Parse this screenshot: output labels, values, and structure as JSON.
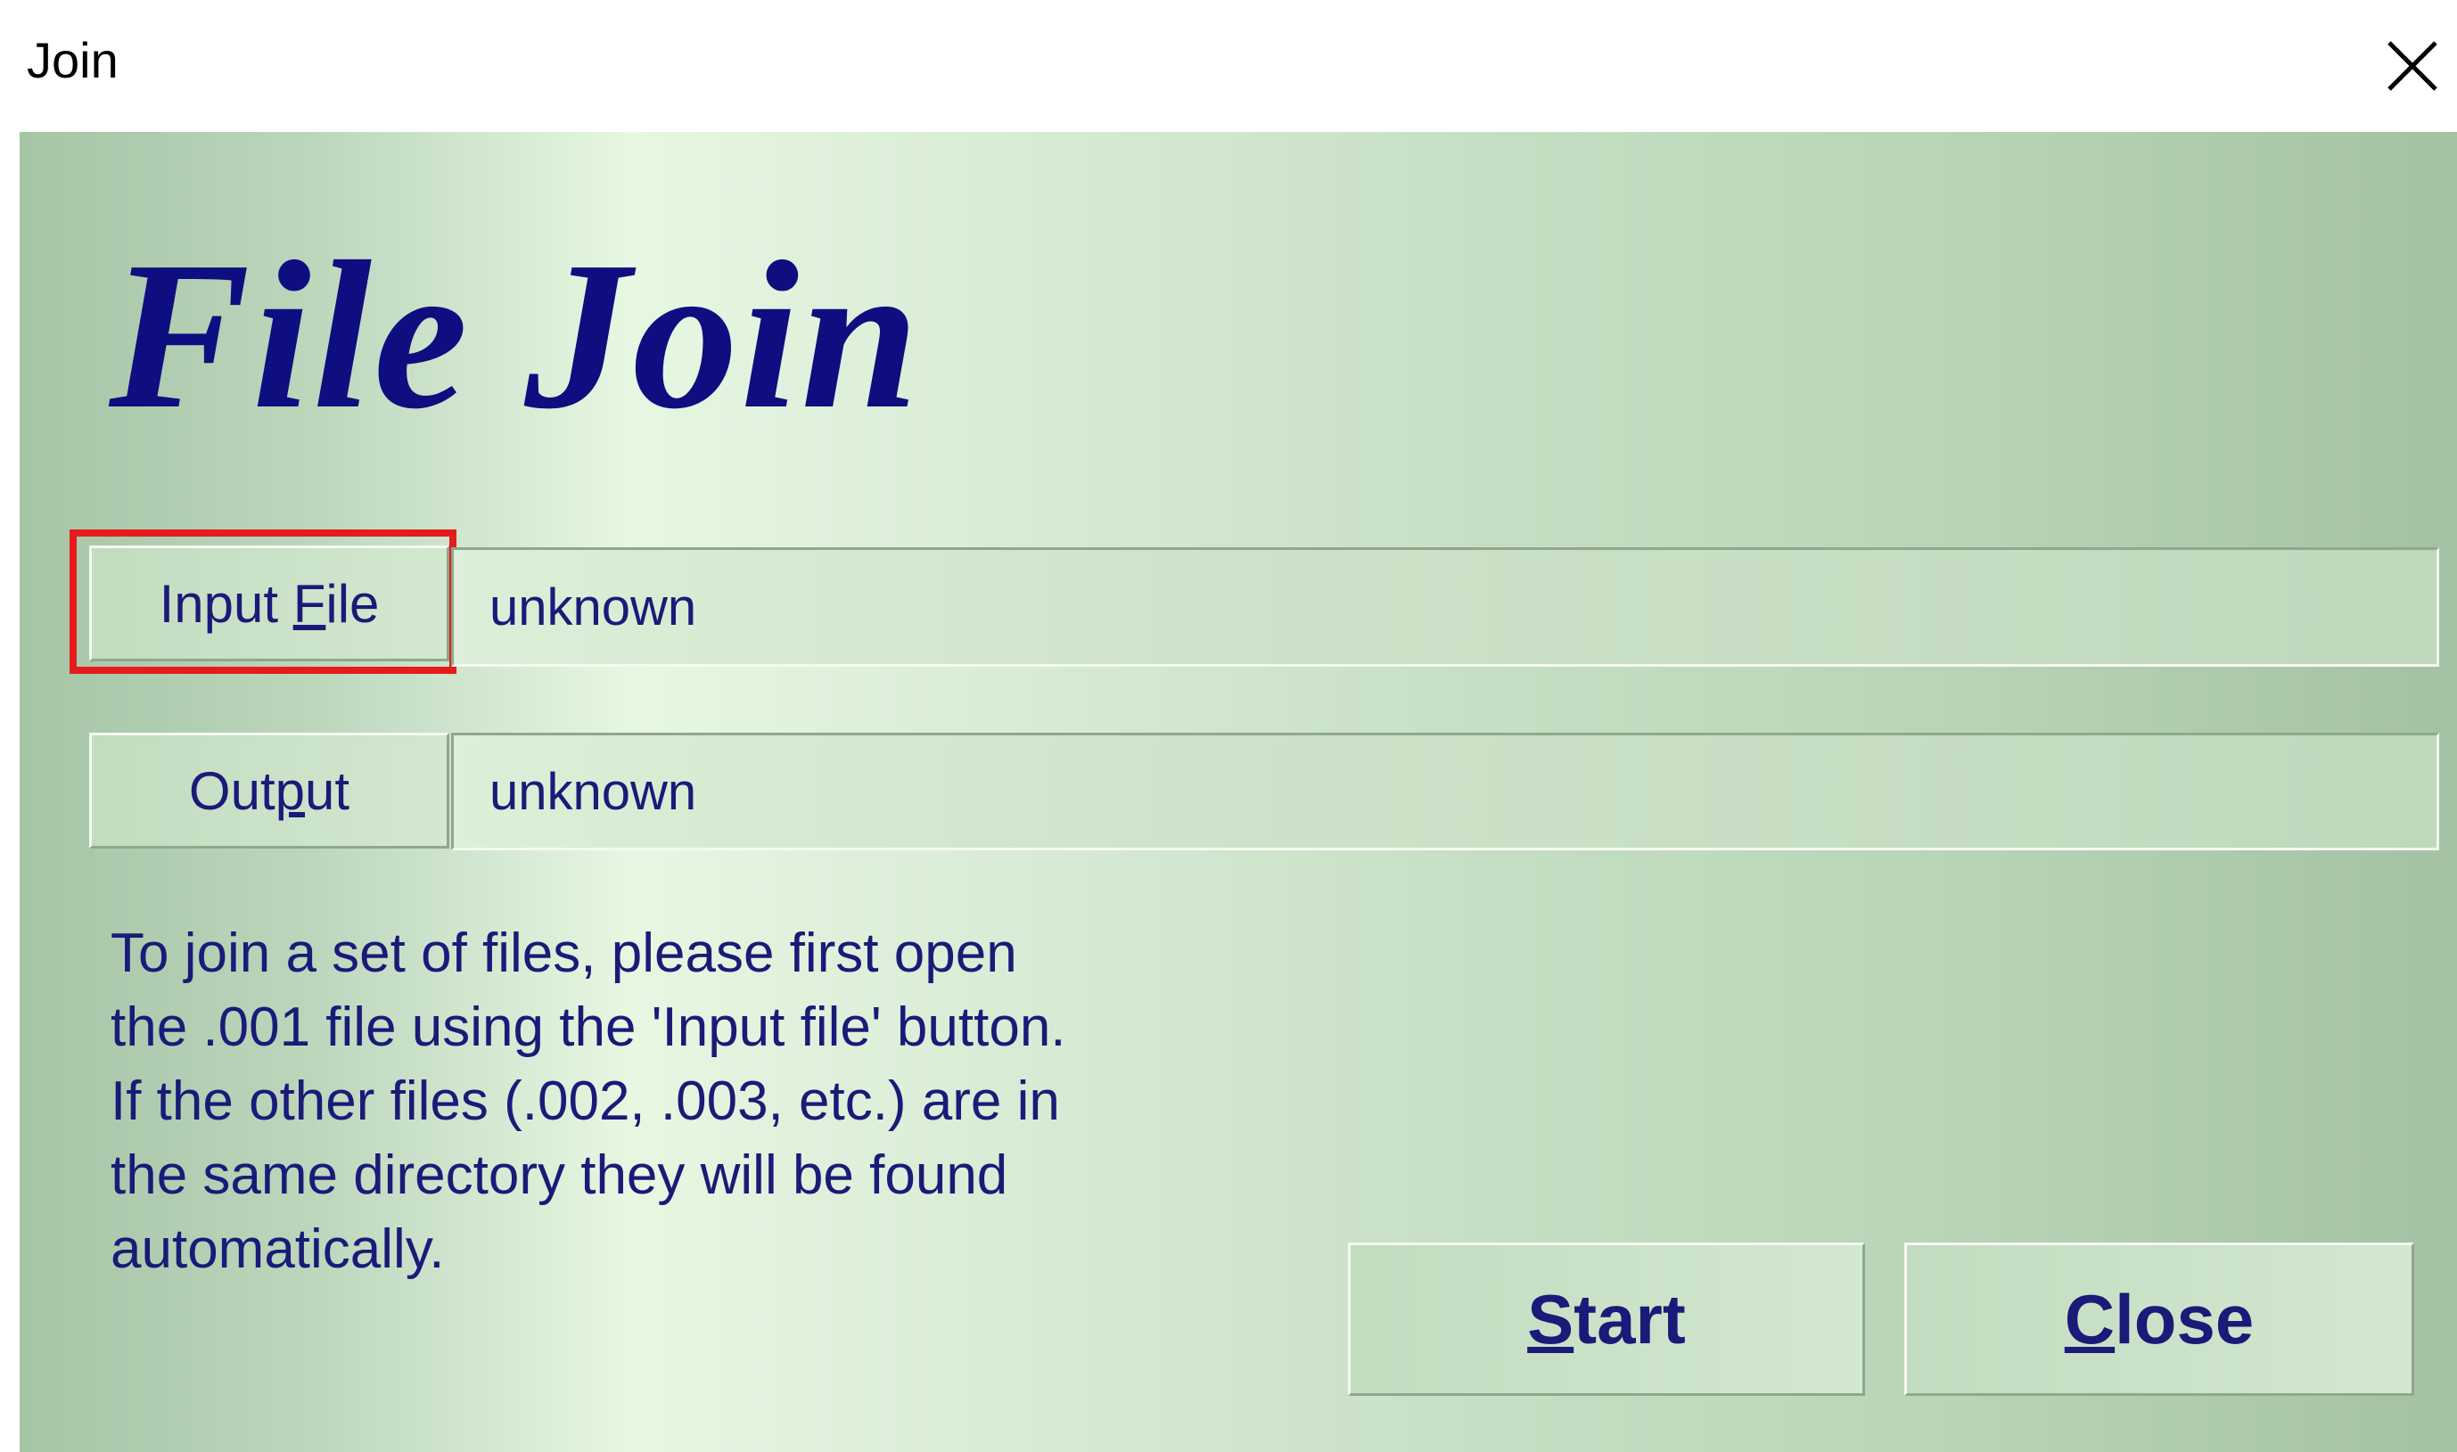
{
  "window": {
    "title": "Join",
    "close_icon": "close-icon"
  },
  "header": {
    "app_title": "File Join"
  },
  "input_row": {
    "button_label_before": "Input ",
    "button_label_accel": "F",
    "button_label_after": "ile",
    "value": "unknown"
  },
  "output_row": {
    "button_label_before": "Out",
    "button_label_accel": "p",
    "button_label_after": "ut",
    "value": "unknown"
  },
  "help_text": [
    "To join a set of files, please first open",
    "the .001 file using the 'Input file' button.",
    "If the other files (.002, .003, etc.) are in",
    "the same directory they will be found",
    "automatically."
  ],
  "actions": {
    "start_accel": "S",
    "start_rest": "tart",
    "close_accel": "C",
    "close_rest": "lose"
  },
  "colors": {
    "title": "#0e0e80",
    "text": "#1a1a78",
    "highlight": "#e41c1c"
  }
}
